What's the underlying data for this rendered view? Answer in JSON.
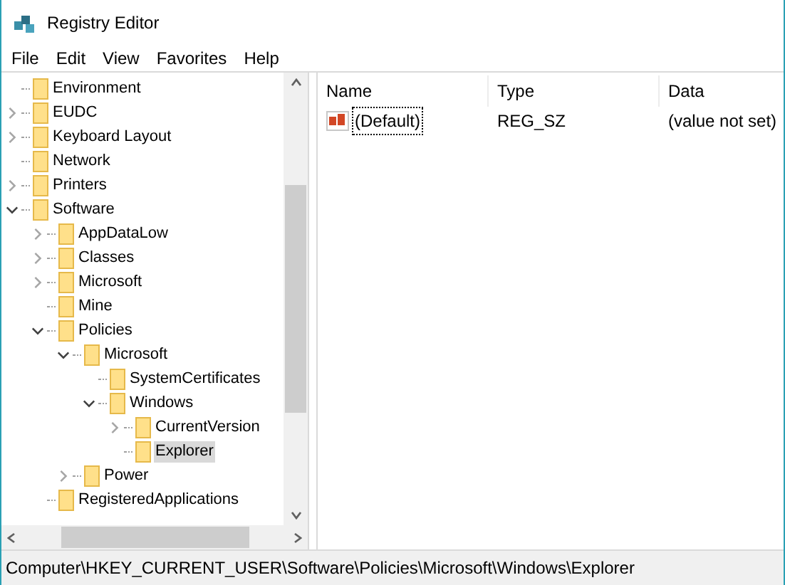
{
  "window": {
    "title": "Registry Editor"
  },
  "menu": [
    "File",
    "Edit",
    "View",
    "Favorites",
    "Help"
  ],
  "tree": [
    {
      "label": "Environment",
      "selected": false
    },
    {
      "label": "EUDC",
      "expanded": false,
      "selected": false
    },
    {
      "label": "Keyboard Layout",
      "expanded": false,
      "selected": false
    },
    {
      "label": "Network",
      "selected": false
    },
    {
      "label": "Printers",
      "expanded": false,
      "selected": false
    },
    {
      "label": "Software",
      "expanded": true,
      "selected": false,
      "children": [
        {
          "label": "AppDataLow",
          "expanded": false,
          "selected": false
        },
        {
          "label": "Classes",
          "expanded": false,
          "selected": false
        },
        {
          "label": "Microsoft",
          "expanded": false,
          "selected": false
        },
        {
          "label": "Mine",
          "selected": false
        },
        {
          "label": "Policies",
          "expanded": true,
          "selected": false,
          "children": [
            {
              "label": "Microsoft",
              "expanded": true,
              "selected": false,
              "children": [
                {
                  "label": "SystemCertificates",
                  "selected": false
                },
                {
                  "label": "Windows",
                  "expanded": true,
                  "selected": false,
                  "children": [
                    {
                      "label": "CurrentVersion",
                      "expanded": false,
                      "selected": false
                    },
                    {
                      "label": "Explorer",
                      "selected": true
                    }
                  ]
                }
              ]
            },
            {
              "label": "Power",
              "expanded": false,
              "selected": false
            }
          ]
        },
        {
          "label": "RegisteredApplications",
          "selected": false
        }
      ]
    }
  ],
  "table": {
    "columns": [
      "Name",
      "Type",
      "Data"
    ],
    "rows": [
      {
        "name": "(Default)",
        "type": "REG_SZ",
        "data": "(value not set)",
        "focused": true
      }
    ]
  },
  "status_bar": "Computer\\HKEY_CURRENT_USER\\Software\\Policies\\Microsoft\\Windows\\Explorer"
}
